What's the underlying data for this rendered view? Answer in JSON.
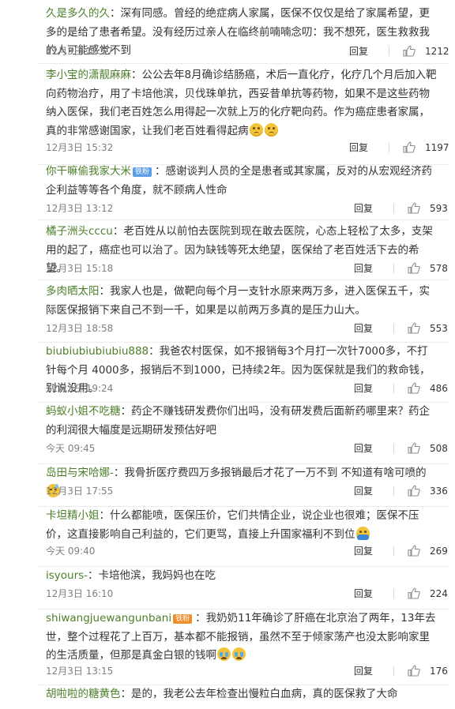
{
  "reply_label": "回复",
  "comments": [
    {
      "user": "久是多久的久",
      "segments": [
        {
          "t": "text",
          "v": "：深有同感。曾经的绝症病人家属，医保不仅仅是给了家属希望，更多的是给了患者希望。没有经历过亲人在临终前喃喃念叨：我不想死，医生救救我的人可能感觉不到"
        }
      ],
      "time": "12月3日 12:57",
      "likes": "1212"
    },
    {
      "user": "李小宝的潇靓麻麻",
      "segments": [
        {
          "t": "text",
          "v": "：公公去年8月确诊结肠癌，术后一直化疗，化疗几个月后加入靶向药物治疗，用了卡培他滨，贝伐珠单抗，西妥昔单抗等药物，如果不是这些药物纳入医保，我们老百姓怎么用得起一次就上万的化疗靶向药。作为癌症患者家属，真的非常感谢国家，让我们老百姓看得起病"
        },
        {
          "t": "emoji",
          "v": "sad"
        },
        {
          "t": "emoji",
          "v": "sad"
        }
      ],
      "time": "12月3日 15:32",
      "likes": "1197"
    },
    {
      "user": "你干嘛偷我家大米",
      "badge": {
        "text": "铁粉",
        "color": "blue"
      },
      "segments": [
        {
          "t": "text",
          "v": "：感谢谈判人员的全是患者或其家属，反对的从宏观经济药企利益等等各个角度，就不顾病人性命"
        }
      ],
      "time": "12月3日 13:12",
      "likes": "593"
    },
    {
      "user": "橘子洲头cccu",
      "segments": [
        {
          "t": "text",
          "v": "：老百姓从以前怕去医院到现在敢去医院，心态上轻松了太多，支架用的起了，癌症也可以治了。因为缺钱等死太绝望，医保给了老百姓活下去的希望。"
        }
      ],
      "time": "12月3日 15:18",
      "likes": "578"
    },
    {
      "user": "多肉晒太阳",
      "segments": [
        {
          "t": "text",
          "v": "：我家人也是，做靶向每个月一支针水原来两万多，进入医保五千，实际医保报销下来自己不到一千，如果是以前两万多真的是压力山大。"
        }
      ],
      "time": "12月3日 18:58",
      "likes": "553"
    },
    {
      "user": "biubiubiubiubiu888",
      "segments": [
        {
          "t": "text",
          "v": "：我爸农村医保，如不报销每3个月打一次针7000多，不打针每个月 4000多，报销后不到1000，已持续2年。因为医保就是我们的救命钱，别说没用。"
        }
      ],
      "time": "12月3日 19:24",
      "likes": "486"
    },
    {
      "user": "蚂蚁小姐不吃糖",
      "segments": [
        {
          "t": "text",
          "v": "：药企不赚钱研发费你们出吗，没有研发费后面新药哪里来？药企的利润很大幅度是远期研发预估好吧"
        }
      ],
      "time": "今天 09:45",
      "likes": "508"
    },
    {
      "user": "岛田与宋哈娜-",
      "segments": [
        {
          "t": "text",
          "v": "：我骨折医疗费四万多报销最后才花了一万不到 不知道有啥可喷的"
        },
        {
          "t": "emoji",
          "v": "sweat"
        }
      ],
      "time": "12月3日 17:55",
      "likes": "336"
    },
    {
      "user": "卡坦精小姐",
      "segments": [
        {
          "t": "text",
          "v": "：什么都能喷，医保压价，它们共情企业，说企业也很难；医保不压价，这直接影响自己利益的，它们更骂，直接上升国家福利不到位"
        },
        {
          "t": "emoji",
          "v": "hands"
        }
      ],
      "time": "今天 09:40",
      "likes": "269"
    },
    {
      "user": "isyours-",
      "segments": [
        {
          "t": "text",
          "v": "：卡培他滨，我妈妈也在吃"
        }
      ],
      "time": "12月3日 16:10",
      "likes": "224"
    },
    {
      "user": "shiwangjuewangunbani",
      "badge": {
        "text": "铁粉",
        "color": "orange"
      },
      "segments": [
        {
          "t": "text",
          "v": "：我奶奶11年确诊了肝癌在北京治了两年，13年去世，整个过程花了上百万，基本都不能报销，虽然不至于倾家荡产也没太影响家里的生活质量，但那是真金白银的钱啊"
        },
        {
          "t": "emoji",
          "v": "cry"
        },
        {
          "t": "emoji",
          "v": "cry"
        }
      ],
      "time": "12月3日 13:15",
      "likes": "176"
    },
    {
      "user": "胡啦啦的糖黄色",
      "segments": [
        {
          "t": "text",
          "v": "：是的，我老公去年检查出慢粒白血病，真的医保救了大命"
        }
      ],
      "time": "",
      "likes": ""
    }
  ]
}
